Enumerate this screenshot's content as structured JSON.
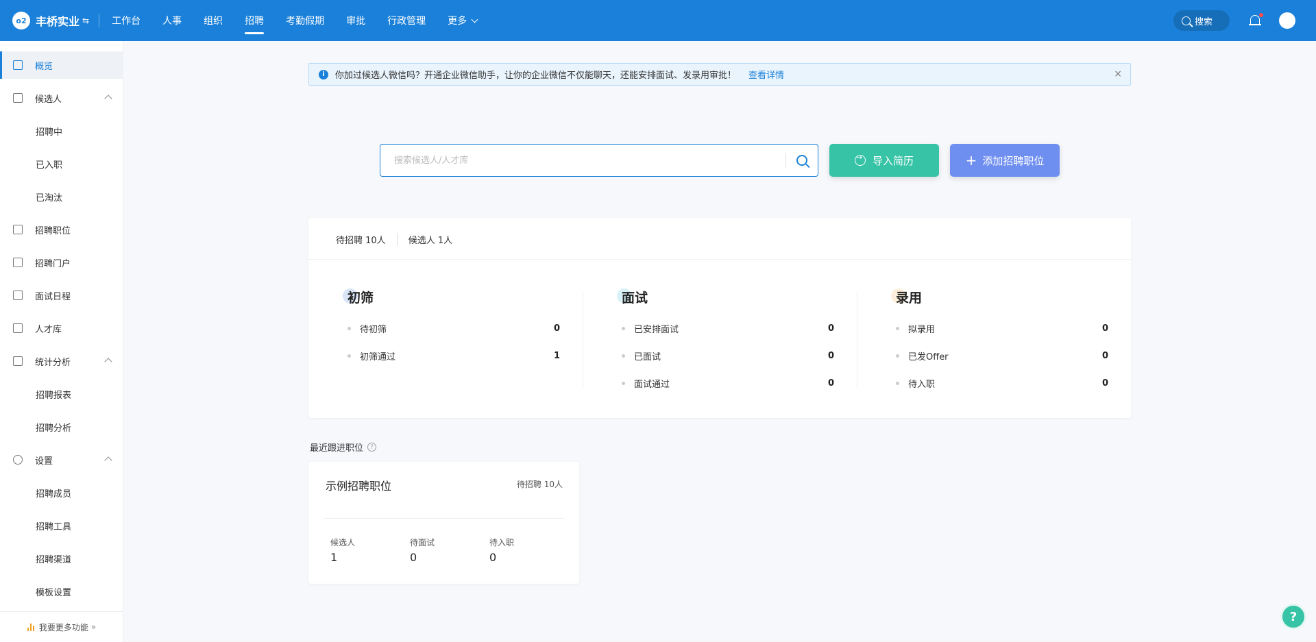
{
  "brand": {
    "logo": "o2",
    "name": "丰桥实业",
    "switch_icon": "switch-icon"
  },
  "nav": {
    "items": [
      "工作台",
      "人事",
      "组织",
      "招聘",
      "考勤假期",
      "审批",
      "行政管理"
    ],
    "active": "招聘",
    "more": "更多"
  },
  "topright": {
    "search": "搜索"
  },
  "sidebar": {
    "overview": "概览",
    "candidates": "候选人",
    "recruiting": "招聘中",
    "onboarded": "已入职",
    "eliminated": "已淘汰",
    "positions": "招聘职位",
    "portal": "招聘门户",
    "schedule": "面试日程",
    "talent": "人才库",
    "analytics": "统计分析",
    "report": "招聘报表",
    "analysis": "招聘分析",
    "settings": "设置",
    "members": "招聘成员",
    "tools": "招聘工具",
    "channels": "招聘渠道",
    "templates": "模板设置",
    "footer": "我要更多功能"
  },
  "notice": {
    "text": "你加过候选人微信吗？开通企业微信助手，让你的企业微信不仅能聊天，还能安排面试、发录用审批！",
    "link": "查看详情",
    "close": "×"
  },
  "search": {
    "placeholder": "搜索候选人/人才库"
  },
  "actions": {
    "import": "导入简历",
    "add": "添加招聘职位"
  },
  "stats": {
    "tabs": [
      "待招聘 10人",
      "候选人 1人"
    ],
    "screening": {
      "title": "初筛",
      "color": "#8fb8ec",
      "rows": [
        {
          "label": "待初筛",
          "value": "0"
        },
        {
          "label": "初筛通过",
          "value": "1"
        }
      ]
    },
    "interview": {
      "title": "面试",
      "color": "#8fd6e8",
      "rows": [
        {
          "label": "已安排面试",
          "value": "0"
        },
        {
          "label": "已面试",
          "value": "0"
        },
        {
          "label": "面试通过",
          "value": "0"
        }
      ]
    },
    "hire": {
      "title": "录用",
      "color": "#f5d29a",
      "rows": [
        {
          "label": "拟录用",
          "value": "0"
        },
        {
          "label": "已发Offer",
          "value": "0"
        },
        {
          "label": "待入职",
          "value": "0"
        }
      ]
    }
  },
  "recent": {
    "title": "最近跟进职位",
    "job": {
      "name": "示例招聘职位",
      "pending": "待招聘 10人",
      "candidates_label": "候选人",
      "candidates": "1",
      "interview_label": "待面试",
      "interview": "0",
      "onboard_label": "待入职",
      "onboard": "0"
    }
  },
  "help": "?"
}
